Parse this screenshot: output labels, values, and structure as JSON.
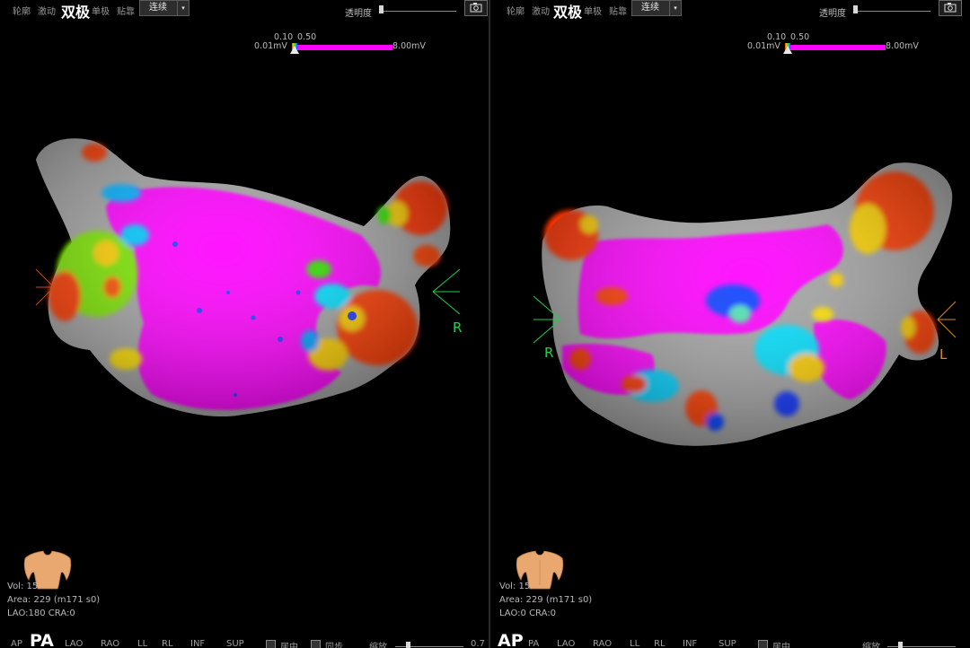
{
  "toolbar": {
    "mode_contour": "轮廓",
    "mode_activation": "激动",
    "mode_bipolar": "双极",
    "mode_unipolar": "单极",
    "mode_tag": "贴靠",
    "display_mode": "连续",
    "opacity_label": "透明度"
  },
  "scale": {
    "low_threshold": "0.10",
    "high_threshold": "0.50",
    "min": "0.01mV",
    "max": "8.00mV"
  },
  "left": {
    "side_label": "R",
    "vol": "Vol: 15",
    "area": "Area: 229 (m171 s0)",
    "angle": "LAO:180 CRA:0",
    "active_view": "PA",
    "views": [
      "AP",
      "PA",
      "LAO",
      "RAO",
      "LL",
      "RL",
      "INF",
      "SUP"
    ],
    "check1": "居中",
    "check2": "同步",
    "zoom_label": "缩放",
    "zoom_value": "0.7"
  },
  "right": {
    "side_label_left": "R",
    "side_label_right": "L",
    "vol": "Vol: 15",
    "area": "Area: 229 (m171 s0)",
    "angle": "LAO:0 CRA:0",
    "active_view": "AP",
    "views": [
      "AP",
      "PA",
      "LAO",
      "RAO",
      "LL",
      "RL",
      "INF",
      "SUP"
    ],
    "check1": "居中",
    "zoom_label": "缩放"
  },
  "colors": {
    "voltage_high": "#ff00ff",
    "scar": "#ff2a00",
    "unmapped": "#a8a8a8",
    "marker": "#1fcf4a"
  }
}
